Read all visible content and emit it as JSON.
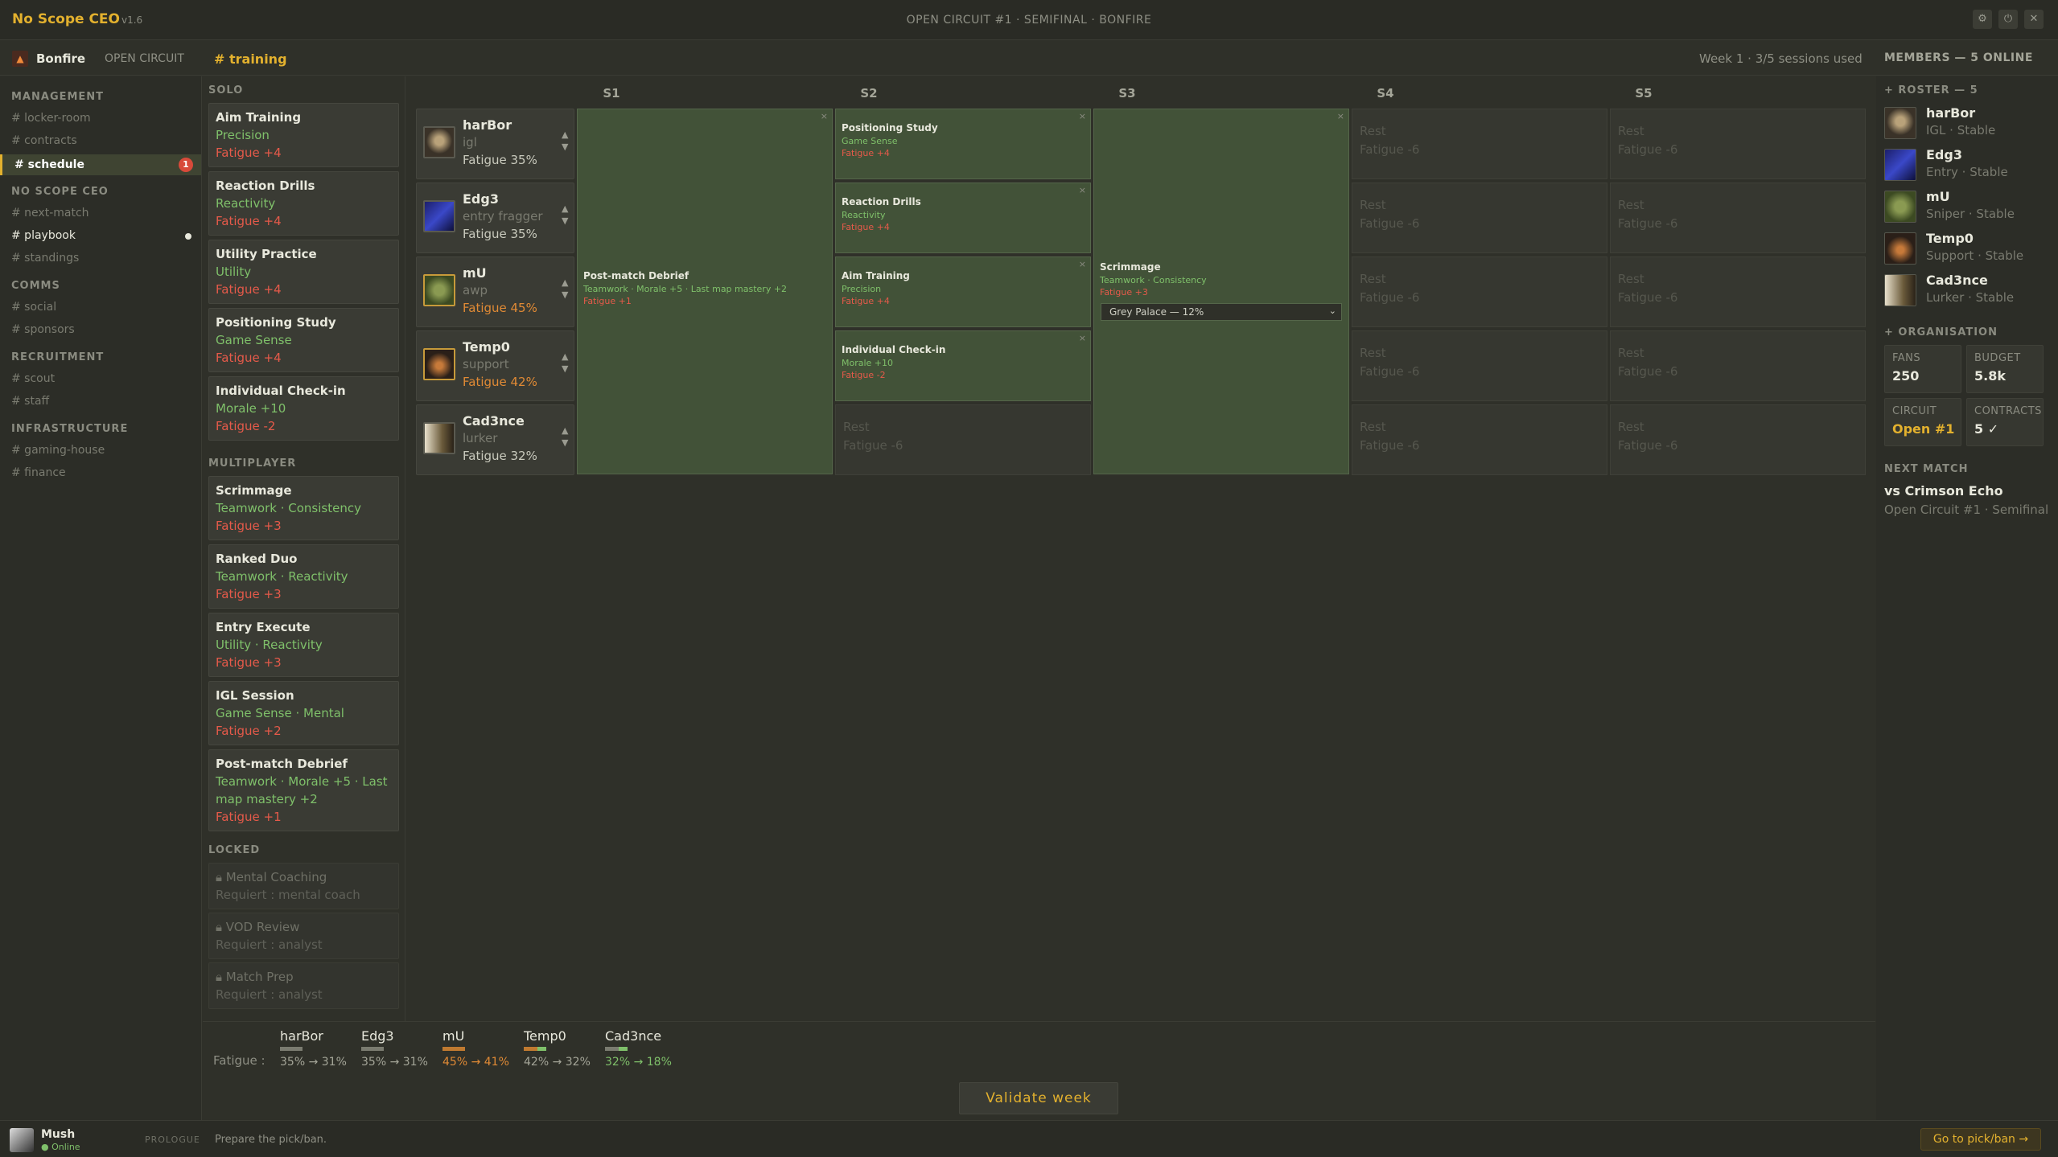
{
  "app": {
    "name": "No Scope CEO",
    "version": "v1.6",
    "window_title": "OPEN CIRCUIT #1 · SEMIFINAL · BONFIRE"
  },
  "topnav": {
    "server": "Bonfire",
    "server_sub": "OPEN CIRCUIT",
    "channel": "# training",
    "week_info": "Week 1 · 3/5 sessions used",
    "members_title": "MEMBERS — 5 ONLINE"
  },
  "sidebar": {
    "sections": [
      {
        "title": "MANAGEMENT",
        "items": [
          "# locker-room",
          "# contracts",
          "# schedule"
        ]
      },
      {
        "title": "NO SCOPE CEO",
        "items": [
          "# next-match",
          "# playbook",
          "# standings"
        ]
      },
      {
        "title": "COMMS",
        "items": [
          "# social",
          "# sponsors"
        ]
      },
      {
        "title": "RECRUITMENT",
        "items": [
          "# scout",
          "# staff"
        ]
      },
      {
        "title": "INFRASTRUCTURE",
        "items": [
          "# gaming-house",
          "# finance"
        ]
      }
    ],
    "active": "# schedule",
    "schedule_badge": "1"
  },
  "activities": {
    "solo_title": "SOLO",
    "solo": [
      {
        "name": "Aim Training",
        "stat": "Precision",
        "fatigue": "Fatigue +4"
      },
      {
        "name": "Reaction Drills",
        "stat": "Reactivity",
        "fatigue": "Fatigue +4"
      },
      {
        "name": "Utility Practice",
        "stat": "Utility",
        "fatigue": "Fatigue +4"
      },
      {
        "name": "Positioning Study",
        "stat": "Game Sense",
        "fatigue": "Fatigue +4"
      },
      {
        "name": "Individual Check-in",
        "stat": "Morale +10",
        "fatigue": "Fatigue -2"
      }
    ],
    "multi_title": "MULTIPLAYER",
    "multi": [
      {
        "name": "Scrimmage",
        "stat": "Teamwork · Consistency",
        "fatigue": "Fatigue +3"
      },
      {
        "name": "Ranked Duo",
        "stat": "Teamwork · Reactivity",
        "fatigue": "Fatigue +3"
      },
      {
        "name": "Entry Execute",
        "stat": "Utility · Reactivity",
        "fatigue": "Fatigue +3"
      },
      {
        "name": "IGL Session",
        "stat": "Game Sense · Mental",
        "fatigue": "Fatigue +2"
      },
      {
        "name": "Post-match Debrief",
        "stat": "Teamwork · Morale +5 · Last map mastery +2",
        "fatigue": "Fatigue +1"
      }
    ],
    "locked_title": "LOCKED",
    "locked": [
      {
        "name": "Mental Coaching",
        "req": "Requiert : mental coach"
      },
      {
        "name": "VOD Review",
        "req": "Requiert : analyst"
      },
      {
        "name": "Match Prep",
        "req": "Requiert : analyst"
      }
    ]
  },
  "board": {
    "columns": [
      "S1",
      "S2",
      "S3",
      "S4",
      "S5"
    ],
    "players": [
      {
        "name": "harBor",
        "role": "igl",
        "fatigue": "Fatigue 35%"
      },
      {
        "name": "Edg3",
        "role": "entry fragger",
        "fatigue": "Fatigue 35%"
      },
      {
        "name": "mU",
        "role": "awp",
        "fatigue": "Fatigue 45%"
      },
      {
        "name": "Temp0",
        "role": "support",
        "fatigue": "Fatigue 42%"
      },
      {
        "name": "Cad3nce",
        "role": "lurker",
        "fatigue": "Fatigue 32%"
      }
    ],
    "s1": {
      "name": "Post-match Debrief",
      "stat": "Teamwork · Morale +5 · Last map mastery +2",
      "fatigue": "Fatigue +1"
    },
    "s2": [
      {
        "name": "Positioning Study",
        "stat": "Game Sense",
        "fatigue": "Fatigue +4"
      },
      {
        "name": "Reaction Drills",
        "stat": "Reactivity",
        "fatigue": "Fatigue +4"
      },
      {
        "name": "Aim Training",
        "stat": "Precision",
        "fatigue": "Fatigue +4"
      },
      {
        "name": "Individual Check-in",
        "stat": "Morale +10",
        "fatigue": "Fatigue -2"
      }
    ],
    "s3": {
      "name": "Scrimmage",
      "stat": "Teamwork · Consistency",
      "fatigue": "Fatigue +3",
      "map": "Grey Palace — 12%"
    },
    "rest": {
      "label": "Rest",
      "fatigue": "Fatigue -6"
    },
    "close": "×"
  },
  "footer": {
    "label": "Fatigue :",
    "players": [
      {
        "name": "harBor",
        "change": "35% → 31%"
      },
      {
        "name": "Edg3",
        "change": "35% → 31%"
      },
      {
        "name": "mU",
        "change": "45% → 41%"
      },
      {
        "name": "Temp0",
        "change": "42% → 32%"
      },
      {
        "name": "Cad3nce",
        "change": "32% → 18%"
      }
    ],
    "validate": "Validate week"
  },
  "members": {
    "roster_title": "+ ROSTER — 5",
    "roster": [
      {
        "name": "harBor",
        "sub": "IGL · Stable"
      },
      {
        "name": "Edg3",
        "sub": "Entry · Stable"
      },
      {
        "name": "mU",
        "sub": "Sniper · Stable"
      },
      {
        "name": "Temp0",
        "sub": "Support · Stable"
      },
      {
        "name": "Cad3nce",
        "sub": "Lurker · Stable"
      }
    ],
    "org_title": "+ ORGANISATION",
    "org": {
      "fans_label": "FANS",
      "fans": "250",
      "budget_label": "BUDGET",
      "budget": "5.8k",
      "circuit_label": "CIRCUIT",
      "circuit": "Open #1",
      "contracts_label": "CONTRACTS",
      "contracts": "5 ✓"
    },
    "next_title": "NEXT MATCH",
    "next_opponent": "vs Crimson Echo",
    "next_event": "Open Circuit #1 · Semifinal"
  },
  "userbar": {
    "name": "Mush",
    "status": "● Online",
    "tag": "PROLOGUE",
    "hint": "Prepare the pick/ban.",
    "go": "Go to pick/ban →"
  },
  "colors": {
    "accent": "#e3b12e",
    "stat_green": "#7fc06a",
    "fatigue_red": "#e55a4a",
    "warn_orange": "#e08a35",
    "slot_filled": "#425238"
  }
}
